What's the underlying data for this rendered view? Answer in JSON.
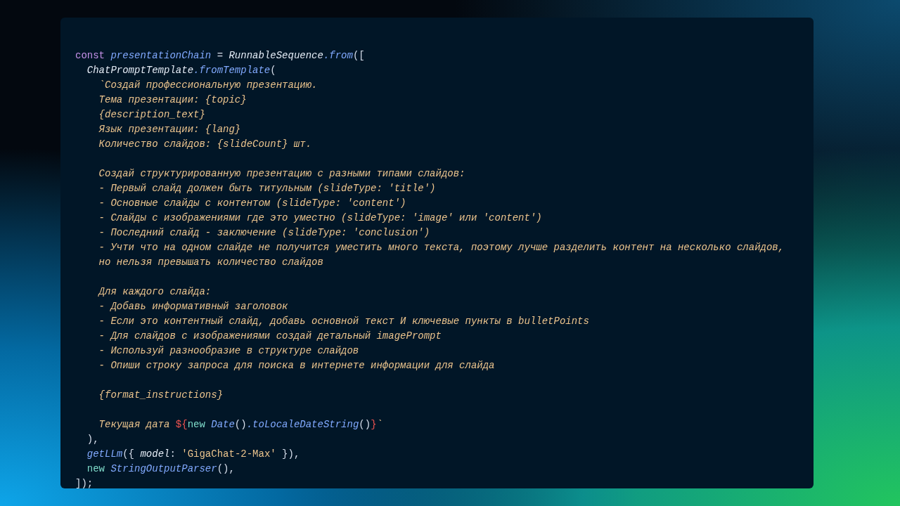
{
  "code_lines": [
    {
      "kind": "code",
      "tokens": [
        {
          "kind": "keyword",
          "text": "const "
        },
        {
          "kind": "variable",
          "text": "presentationChain"
        },
        {
          "kind": "plain",
          "text": " = "
        },
        {
          "kind": "class",
          "text": "RunnableSequence"
        },
        {
          "kind": "function",
          "text": ".from"
        },
        {
          "kind": "plain",
          "text": "(["
        }
      ]
    },
    {
      "kind": "code",
      "tokens": [
        {
          "kind": "class",
          "text": "  ChatPromptTemplate"
        },
        {
          "kind": "function",
          "text": ".fromTemplate"
        },
        {
          "kind": "plain",
          "text": "("
        }
      ]
    },
    {
      "kind": "code",
      "tokens": [
        {
          "kind": "template",
          "text": "    `Создай профессиональную презентацию."
        }
      ]
    },
    {
      "kind": "code",
      "tokens": [
        {
          "kind": "template",
          "text": "    Тема презентации: {topic}"
        }
      ]
    },
    {
      "kind": "code",
      "tokens": [
        {
          "kind": "template",
          "text": "    {description_text}"
        }
      ]
    },
    {
      "kind": "code",
      "tokens": [
        {
          "kind": "template",
          "text": "    Язык презентации: {lang}"
        }
      ]
    },
    {
      "kind": "code",
      "tokens": [
        {
          "kind": "template",
          "text": "    Количество слайдов: {slideCount} шт."
        }
      ]
    },
    {
      "kind": "blank"
    },
    {
      "kind": "code",
      "tokens": [
        {
          "kind": "template",
          "text": "    Создай структурированную презентацию с разными типами слайдов:"
        }
      ]
    },
    {
      "kind": "code",
      "tokens": [
        {
          "kind": "template",
          "text": "    - Первый слайд должен быть титульным (slideType: 'title')"
        }
      ]
    },
    {
      "kind": "code",
      "tokens": [
        {
          "kind": "template",
          "text": "    - Основные слайды с контентом (slideType: 'content')"
        }
      ]
    },
    {
      "kind": "code",
      "tokens": [
        {
          "kind": "template",
          "text": "    - Слайды с изображениями где это уместно (slideType: 'image' или 'content')"
        }
      ]
    },
    {
      "kind": "code",
      "tokens": [
        {
          "kind": "template",
          "text": "    - Последний слайд - заключение (slideType: 'conclusion')"
        }
      ]
    },
    {
      "kind": "code",
      "tokens": [
        {
          "kind": "template",
          "text": "    - Учти что на одном слайде не получится уместить много текста, поэтому лучше разделить контент на несколько слайдов,"
        }
      ]
    },
    {
      "kind": "code",
      "tokens": [
        {
          "kind": "template",
          "text": "    но нельзя превышать количество слайдов"
        }
      ]
    },
    {
      "kind": "blank"
    },
    {
      "kind": "code",
      "tokens": [
        {
          "kind": "template",
          "text": "    Для каждого слайда:"
        }
      ]
    },
    {
      "kind": "code",
      "tokens": [
        {
          "kind": "template",
          "text": "    - Добавь информативный заголовок"
        }
      ]
    },
    {
      "kind": "code",
      "tokens": [
        {
          "kind": "template",
          "text": "    - Если это контентный слайд, добавь основной текст И ключевые пункты в bulletPoints"
        }
      ]
    },
    {
      "kind": "code",
      "tokens": [
        {
          "kind": "template",
          "text": "    - Для слайдов с изображениями создай детальный imagePrompt"
        }
      ]
    },
    {
      "kind": "code",
      "tokens": [
        {
          "kind": "template",
          "text": "    - Используй разнообразие в структуре слайдов"
        }
      ]
    },
    {
      "kind": "code",
      "tokens": [
        {
          "kind": "template",
          "text": "    - Опиши строку запроса для поиска в интернете информации для слайда"
        }
      ]
    },
    {
      "kind": "blank"
    },
    {
      "kind": "code",
      "tokens": [
        {
          "kind": "template",
          "text": "    {format_instructions}"
        }
      ]
    },
    {
      "kind": "blank"
    },
    {
      "kind": "code",
      "tokens": [
        {
          "kind": "template",
          "text": "    Текущая дата "
        },
        {
          "kind": "interpolation",
          "text": "${"
        },
        {
          "kind": "new",
          "text": "new "
        },
        {
          "kind": "function",
          "text": "Date"
        },
        {
          "kind": "plain",
          "text": "()"
        },
        {
          "kind": "function",
          "text": ".toLocaleDateString"
        },
        {
          "kind": "plain",
          "text": "()"
        },
        {
          "kind": "interpolation",
          "text": "}"
        },
        {
          "kind": "template",
          "text": "`"
        }
      ]
    },
    {
      "kind": "code",
      "tokens": [
        {
          "kind": "plain",
          "text": "  ),"
        }
      ]
    },
    {
      "kind": "code",
      "tokens": [
        {
          "kind": "function",
          "text": "  getLLm"
        },
        {
          "kind": "plain",
          "text": "({ "
        },
        {
          "kind": "property",
          "text": "model"
        },
        {
          "kind": "plain",
          "text": ": "
        },
        {
          "kind": "string",
          "text": "'GigaChat-2-Max'"
        },
        {
          "kind": "plain",
          "text": " }),"
        }
      ]
    },
    {
      "kind": "code",
      "tokens": [
        {
          "kind": "new",
          "text": "  new "
        },
        {
          "kind": "function",
          "text": "StringOutputParser"
        },
        {
          "kind": "plain",
          "text": "(),"
        }
      ]
    },
    {
      "kind": "code",
      "tokens": [
        {
          "kind": "plain",
          "text": "]);"
        }
      ]
    }
  ]
}
